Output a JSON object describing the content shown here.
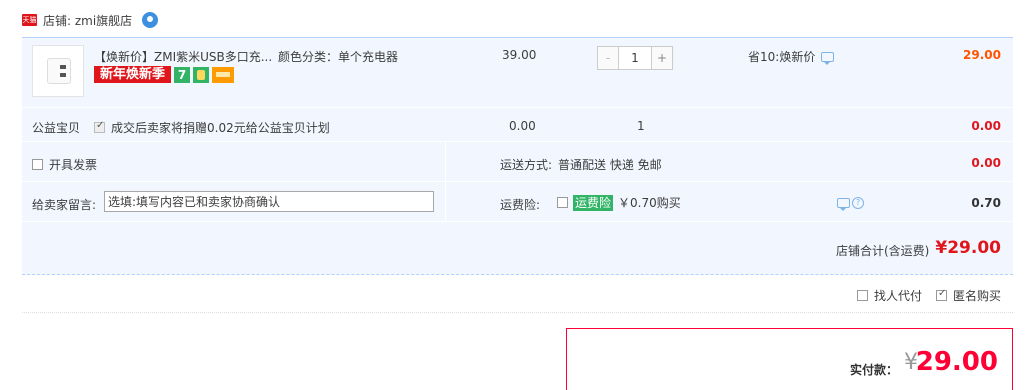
{
  "store": {
    "badge_text": "天猫",
    "name": "店铺: zmi旗舰店",
    "icon": "wangwang-chat-icon"
  },
  "item": {
    "title": "【焕新价】ZMI紫米USB多口充...",
    "sku": "颜色分类：单个充电器",
    "promo_tag": "新年焕新季",
    "seven_day_badge": "7",
    "unit_price": "39.00",
    "quantity": "1",
    "minus_label": "-",
    "plus_label": "+",
    "discount": "省10:焕新价",
    "subtotal": "29.00"
  },
  "charity": {
    "label": "公益宝贝",
    "checkbox_text": "成交后卖家将捐赠0.02元给公益宝贝计划",
    "checked": true,
    "price": "0.00",
    "quantity": "1",
    "total": "0.00"
  },
  "invoice": {
    "label": "开具发票",
    "checked": false
  },
  "shipping": {
    "label": "运送方式:",
    "value": "普通配送 快递 免邮",
    "fee": "0.00"
  },
  "message": {
    "label": "给卖家留言:",
    "placeholder": "选填:填写内容已和卖家协商确认",
    "value": "选填:填写内容已和卖家协商确认"
  },
  "insurance": {
    "label": "运费险:",
    "badge": "运费险",
    "price_text": "￥0.70购买",
    "checked": false,
    "fee": "0.70"
  },
  "store_total": {
    "label": "店铺合计(含运费)",
    "value": "¥29.00"
  },
  "extras": {
    "proxy_pay": "找人代付",
    "proxy_checked": false,
    "anonymous": "匿名购买",
    "anonymous_checked": true
  },
  "payment": {
    "label": "实付款：",
    "currency": "¥",
    "amount": "29.00"
  },
  "colors": {
    "accent_red": "#ff0036",
    "price_orange": "#ff5500",
    "row_bg": "#f2f7ff",
    "border_blue": "#b2d1ff",
    "green_badge": "#31b466"
  }
}
